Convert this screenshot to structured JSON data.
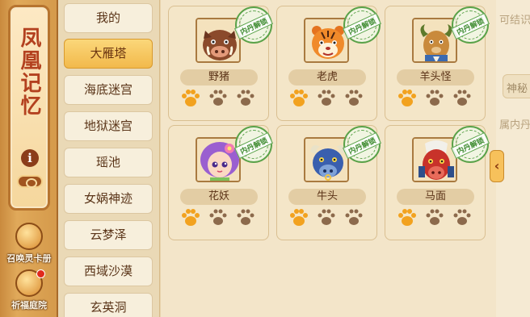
{
  "sidebar": {
    "title": "凤凰记忆",
    "summon_label": "召唤灵卡册",
    "blessing_label": "祈福庭院"
  },
  "tabs": [
    {
      "label": "我的",
      "active": false
    },
    {
      "label": "大雁塔",
      "active": true
    },
    {
      "label": "海底迷宫",
      "active": false
    },
    {
      "label": "地狱迷宫",
      "active": false
    },
    {
      "label": "瑶池",
      "active": false
    },
    {
      "label": "女娲神迹",
      "active": false
    },
    {
      "label": "云梦泽",
      "active": false
    },
    {
      "label": "西域沙漠",
      "active": false
    },
    {
      "label": "玄英洞",
      "active": false
    }
  ],
  "cards": [
    {
      "name": "野猪",
      "stamp": "内丹解锁",
      "paws_filled": 1,
      "paws_total": 3,
      "icon": "boar-portrait-icon"
    },
    {
      "name": "老虎",
      "stamp": "内丹解锁",
      "paws_filled": 1,
      "paws_total": 3,
      "icon": "tiger-portrait-icon"
    },
    {
      "name": "羊头怪",
      "stamp": "内丹解锁",
      "paws_filled": 1,
      "paws_total": 3,
      "icon": "goat-monster-portrait-icon"
    },
    {
      "name": "花妖",
      "stamp": "内丹解锁",
      "paws_filled": 1,
      "paws_total": 3,
      "icon": "flower-fairy-portrait-icon"
    },
    {
      "name": "牛头",
      "stamp": "内丹解锁",
      "paws_filled": 1,
      "paws_total": 3,
      "icon": "ox-head-portrait-icon"
    },
    {
      "name": "马面",
      "stamp": "内丹解锁",
      "paws_filled": 1,
      "paws_total": 3,
      "icon": "horse-face-portrait-icon"
    }
  ],
  "right_panel": {
    "line1": "可结识",
    "box_label": "神秘",
    "line2": "属内丹"
  },
  "colors": {
    "paw_filled": "#f2a21f",
    "paw_empty": "#8c6a4c",
    "stamp_green": "#5aa249",
    "active_tab": "#f2b94b"
  }
}
